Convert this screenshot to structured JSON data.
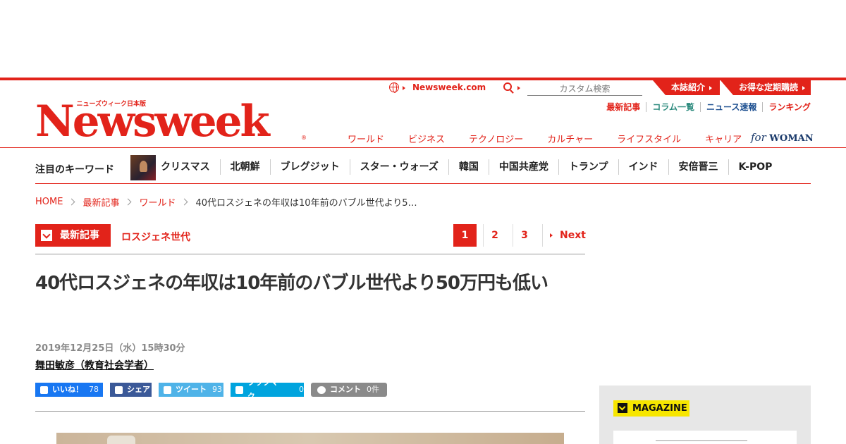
{
  "header": {
    "logo_sub": "ニューズウィーク日本版",
    "logo": "Newsweek",
    "logo_reg": "®",
    "newsweek_com": "Newsweek.com",
    "search_placeholder": "カスタム検索",
    "tab_about": "本誌紹介",
    "tab_subscribe": "お得な定期購読",
    "sublinks": [
      "最新記事",
      "コラム一覧",
      "ニュース速報",
      "ランキング"
    ],
    "categories": [
      "ワールド",
      "ビジネス",
      "テクノロジー",
      "カルチャー",
      "ライフスタイル",
      "キャリア"
    ],
    "for_woman_for": "for",
    "for_woman_woman": "WOMAN"
  },
  "keywords": {
    "label": "注目のキーワード",
    "items": [
      "クリスマス",
      "北朝鮮",
      "ブレグジット",
      "スター・ウォーズ",
      "韓国",
      "中国共産党",
      "トランプ",
      "インド",
      "安倍晋三",
      "K-POP"
    ]
  },
  "breadcrumb": {
    "items": [
      "HOME",
      "最新記事",
      "ワールド"
    ],
    "current": "40代ロスジェネの年収は10年前のバブル世代より5…"
  },
  "section": {
    "badge": "最新記事",
    "topic": "ロスジェネ世代"
  },
  "pager": {
    "pages": [
      "1",
      "2",
      "3"
    ],
    "next": "Next"
  },
  "article": {
    "title": "40代ロスジェネの年収は10年前のバブル世代より50万円も低い",
    "date": "2019年12月25日（水）15時30分",
    "author": "舞田敏彦（教育社会学者）"
  },
  "share": {
    "like_label": "いいね！",
    "like_count": "78",
    "share_label": "シェア",
    "tweet_label": "ツイート",
    "tweet_count": "93",
    "hatena_label": "ブックマーク",
    "hatena_count": "0",
    "comment_label": "コメント",
    "comment_count": "0件"
  },
  "sidebar": {
    "magazine_label": "MAGAZINE"
  },
  "colors": {
    "brand_red": "#e2231a",
    "facebook": "#1877f2",
    "twitter": "#4fb3e8",
    "hatena": "#00a4de",
    "magazine_yellow": "#f7e600"
  }
}
